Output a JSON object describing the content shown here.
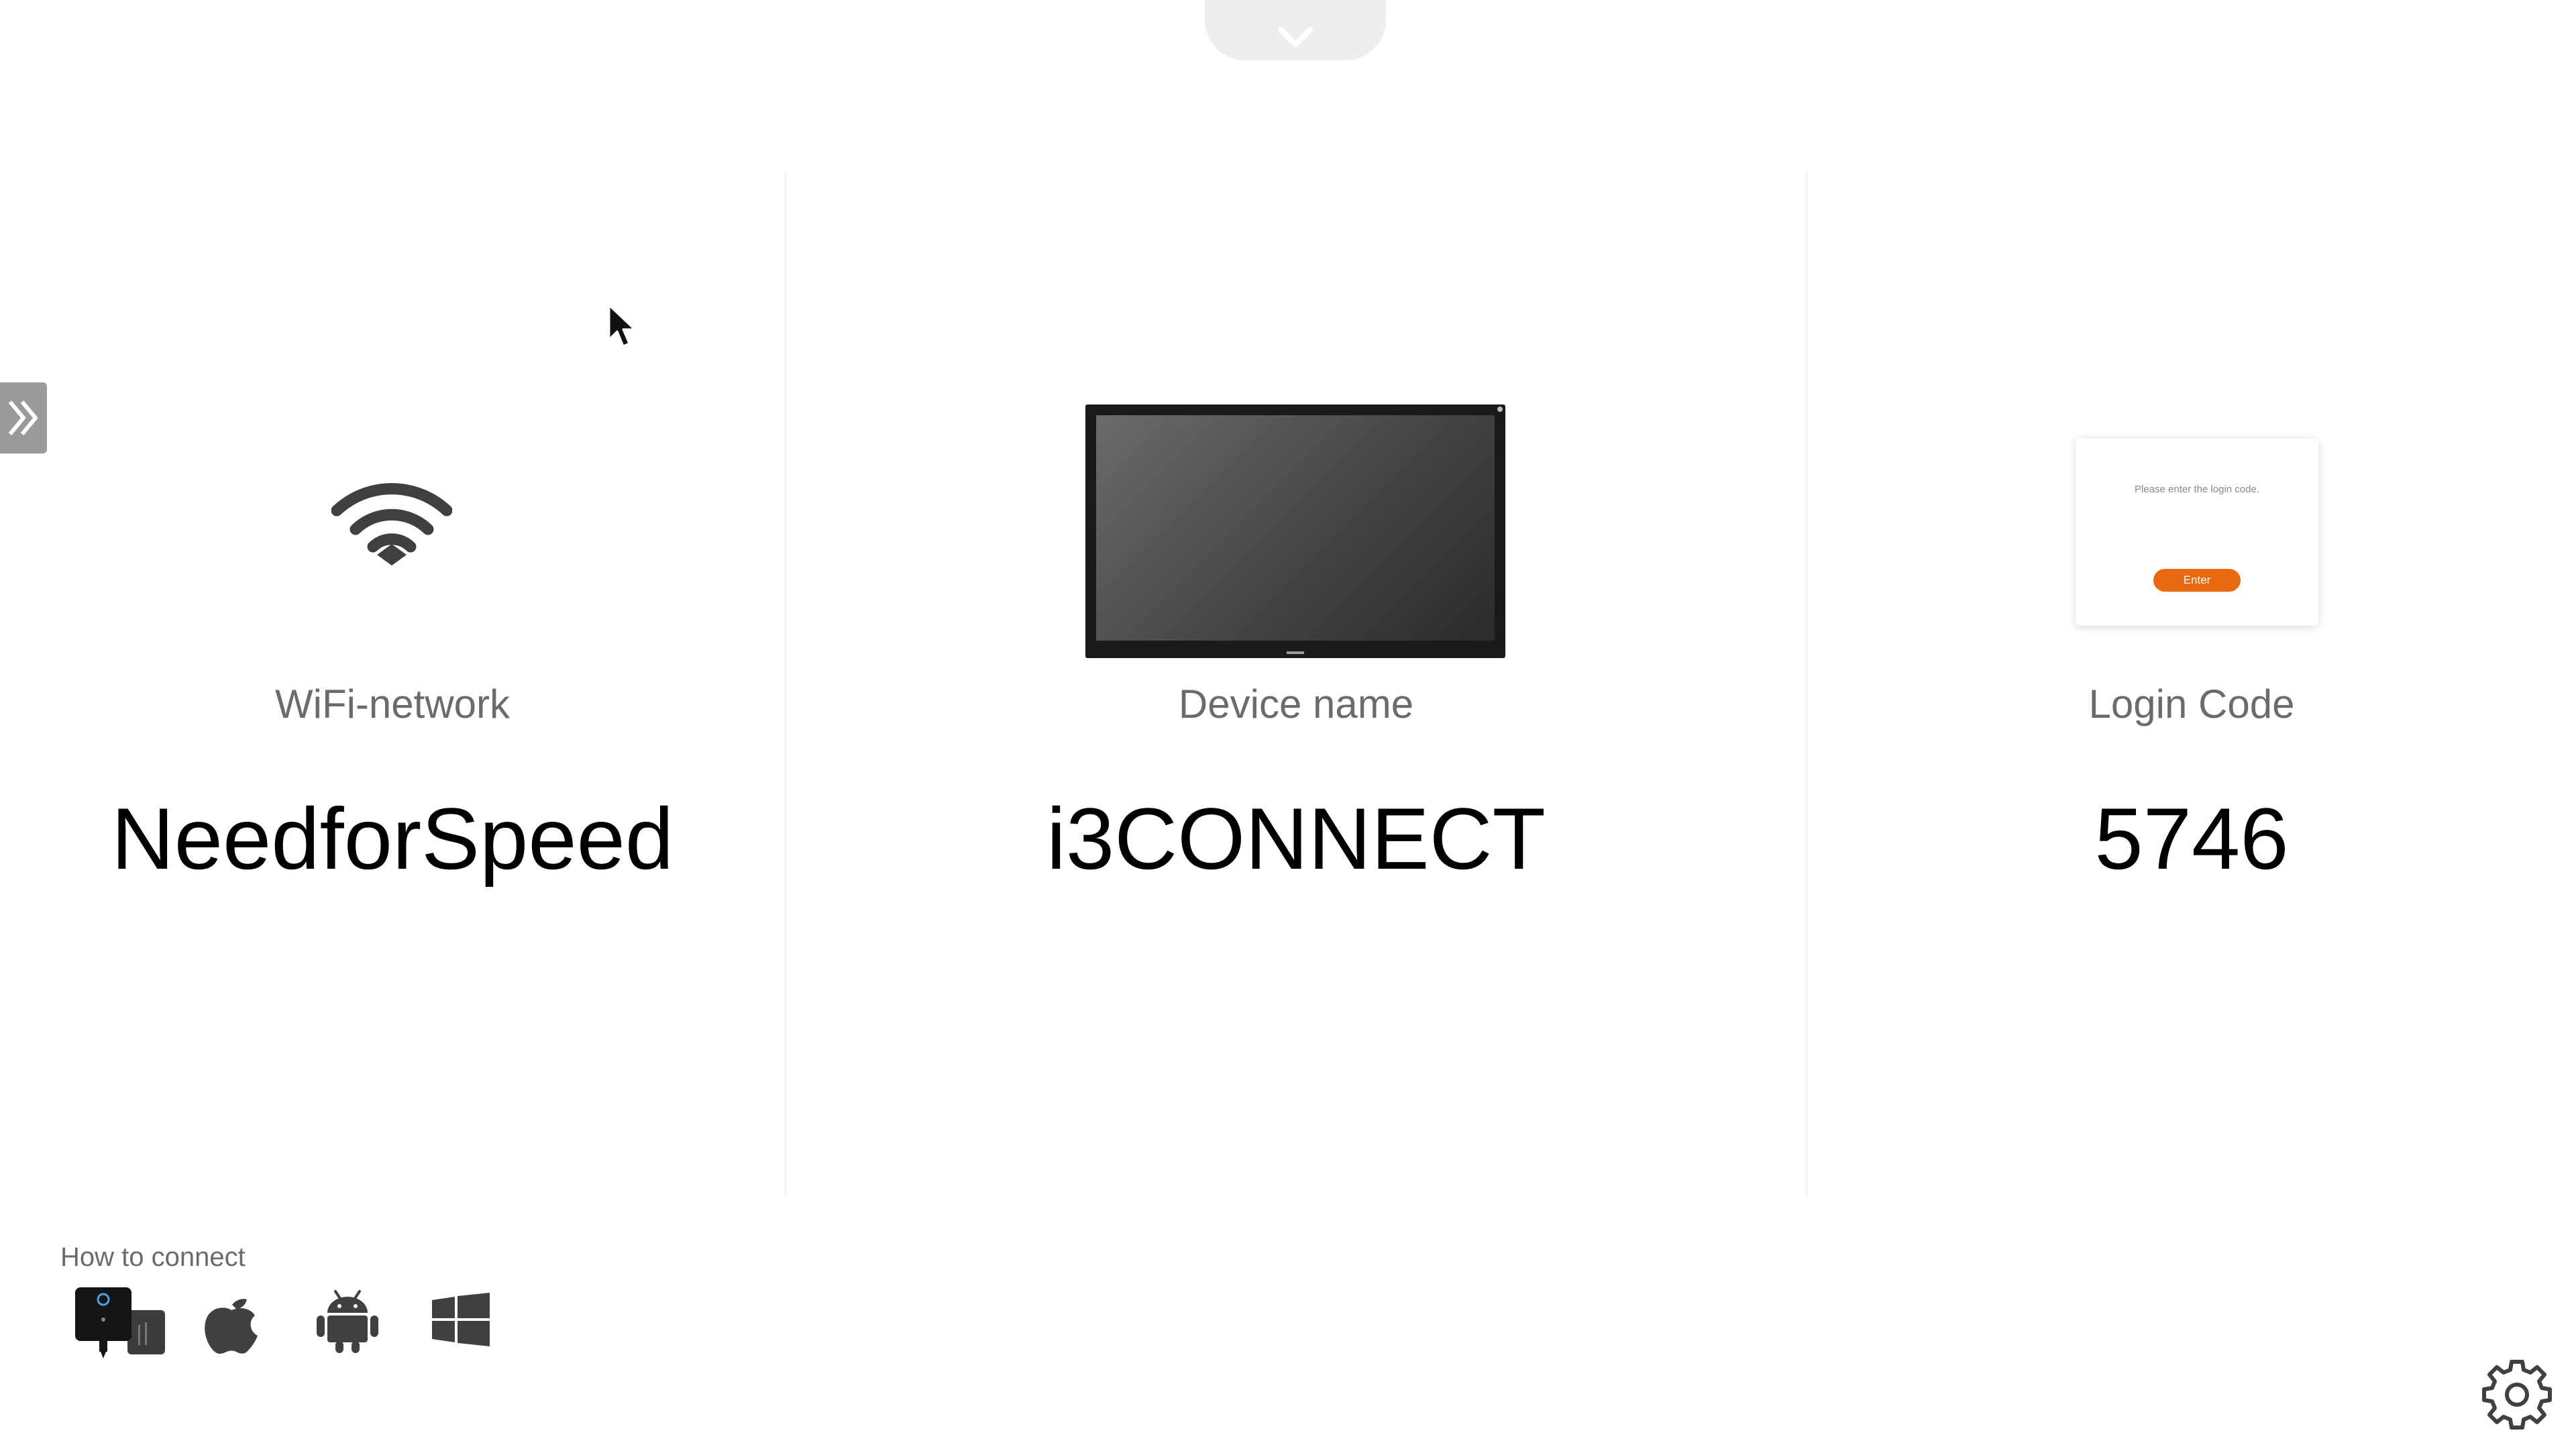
{
  "top_tab": {
    "icon": "chevron-down-icon"
  },
  "side_tab": {
    "icon": "double-chevron-right-icon"
  },
  "wifi": {
    "label": "WiFi-network",
    "value": "NeedforSpeed",
    "icon": "wifi-icon"
  },
  "device": {
    "label": "Device name",
    "value": "i3CONNECT",
    "icon": "display-icon"
  },
  "login": {
    "label": "Login Code",
    "value": "5746",
    "card": {
      "prompt": "Please enter the login code.",
      "button": "Enter"
    }
  },
  "how_to_connect": {
    "label": "How to connect",
    "icons": [
      "dongle-icon",
      "apple-icon",
      "android-icon",
      "windows-icon"
    ]
  },
  "settings": {
    "icon": "gear-icon"
  },
  "colors": {
    "accent": "#e8690f",
    "label": "#6b6b6b",
    "value": "#000000",
    "icon": "#404040",
    "divider": "#efefef"
  }
}
